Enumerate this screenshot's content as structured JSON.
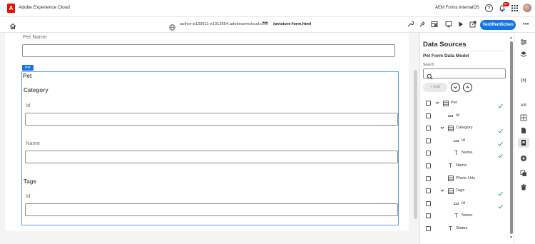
{
  "topbar": {
    "brand_logo_glyph": "A",
    "brand_name": "Adobe Experience Cloud",
    "org_name": "AEM Forms InternalOS",
    "help_glyph": "?",
    "notifications_count": "9+",
    "icons": [
      "adobe-logo",
      "help-icon",
      "bell-icon",
      "apps-grid-icon",
      "avatar"
    ]
  },
  "toolbar": {
    "url_host": "author-p133911-e1313554.adobeaemcloud.com",
    "url_more": "•••",
    "url_path": "/petstore-form.html",
    "publish_label": "Veröffentlichen",
    "more_label": "•••",
    "icons": [
      "home-icon",
      "globe-icon",
      "wrench-icon",
      "pin-icon",
      "layout-icon",
      "device-icon",
      "preview-icon",
      "annotate-icon",
      "open-external-icon"
    ]
  },
  "form": {
    "pet_name_label": "Pet Name",
    "pet_tag": "Pet",
    "pet_panel_title": "Pet",
    "category_title": "Category",
    "category_id_label": "Id",
    "category_name_label": "Name",
    "tags_title": "Tags",
    "tags_id_label": "Id"
  },
  "panel": {
    "heading": "Data Sources",
    "model_title": "Pet Form Data Model",
    "search_label": "Search",
    "search_placeholder": "",
    "add_label": "+ Add",
    "tree": [
      {
        "label": "Pet",
        "type": "object",
        "expanded": true,
        "checked_bound": true
      },
      {
        "label": "Id",
        "type": "number",
        "checked_bound": false
      },
      {
        "label": "Category",
        "type": "object",
        "expanded": true,
        "checked_bound": true
      },
      {
        "label": "Id",
        "type": "number",
        "checked_bound": true
      },
      {
        "label": "Name",
        "type": "text",
        "checked_bound": true
      },
      {
        "label": "Name",
        "type": "text",
        "checked_bound": false
      },
      {
        "label": "Photo Urls",
        "type": "array",
        "checked_bound": false
      },
      {
        "label": "Tags",
        "type": "object",
        "expanded": true,
        "checked_bound": true
      },
      {
        "label": "Id",
        "type": "number",
        "checked_bound": true
      },
      {
        "label": "Name",
        "type": "text",
        "checked_bound": false
      },
      {
        "label": "Status",
        "type": "text",
        "checked_bound": false
      }
    ],
    "type_glyphs": {
      "number": "123",
      "text": "T"
    }
  },
  "rail": {
    "icons": [
      "properties-icon",
      "layers-icon",
      "variables-icon",
      "ab-test-icon",
      "rules-icon",
      "document-icon",
      "data-sources-icon",
      "add-circle-icon",
      "copy-icon",
      "delete-icon"
    ],
    "variables_glyph": "(x)",
    "ab_glyph": "A/B"
  },
  "colors": {
    "accent": "#1473e6",
    "brand": "#eb1000",
    "check": "#2d9d78",
    "badge": "#d31510"
  }
}
